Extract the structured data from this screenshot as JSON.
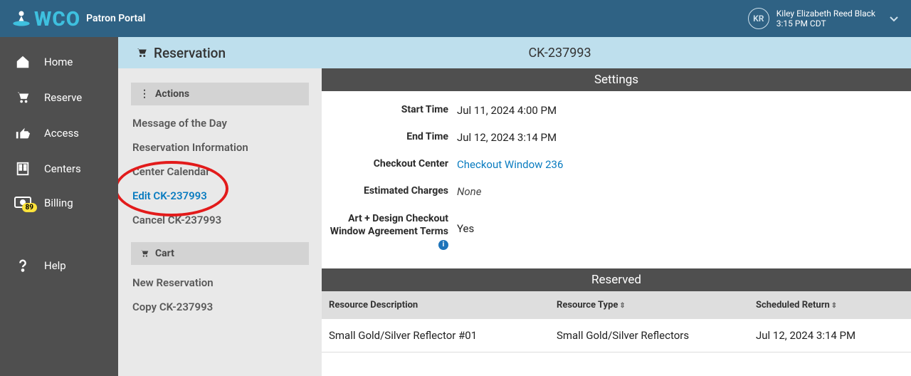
{
  "brand": {
    "wco": "WCO",
    "portal": "Patron Portal"
  },
  "user": {
    "initials": "KR",
    "name": "Kiley Elizabeth Reed Black",
    "time": "3:15 PM CDT"
  },
  "nav": {
    "home": "Home",
    "reserve": "Reserve",
    "access": "Access",
    "centers": "Centers",
    "billing": "Billing",
    "billing_count": "89",
    "help": "Help"
  },
  "page": {
    "title": "Reservation",
    "id": "CK-237993"
  },
  "actions": {
    "header": "Actions",
    "motd": "Message of the Day",
    "resinfo": "Reservation Information",
    "calendar": "Center Calendar",
    "edit": "Edit CK-237993",
    "cancel": "Cancel CK-237993"
  },
  "cart": {
    "header": "Cart",
    "newres": "New Reservation",
    "copy": "Copy CK-237993"
  },
  "settings": {
    "header": "Settings",
    "start_label": "Start Time",
    "start_value": "Jul 11, 2024 4:00 PM",
    "end_label": "End Time",
    "end_value": "Jul 12, 2024 3:14 PM",
    "cc_label": "Checkout Center",
    "cc_value": "Checkout Window 236",
    "est_label": "Estimated Charges",
    "est_value": "None",
    "agree_label": "Art + Design Checkout Window Agreement Terms",
    "agree_value": "Yes"
  },
  "reserved": {
    "header": "Reserved",
    "col_desc": "Resource Description",
    "col_type": "Resource Type",
    "col_ret": "Scheduled Return",
    "rows": [
      {
        "desc": "Small Gold/Silver Reflector #01",
        "type": "Small Gold/Silver Reflectors",
        "ret": "Jul 12, 2024 3:14 PM"
      }
    ]
  }
}
